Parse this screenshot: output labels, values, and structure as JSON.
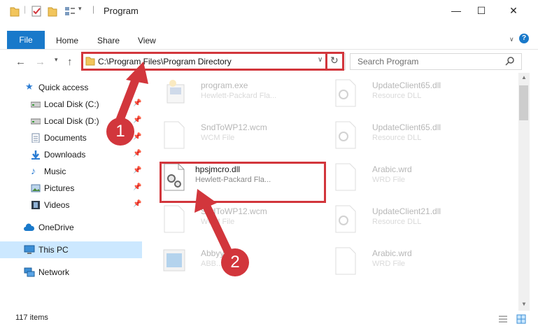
{
  "window": {
    "title": "Program",
    "minimize": "—",
    "maximize": "☐",
    "close": "✕"
  },
  "ribbon": {
    "tabs": [
      "File",
      "Home",
      "Share",
      "View"
    ]
  },
  "address": {
    "path": "C:\\Program Files\\Program Directory",
    "search_placeholder": "Search Program"
  },
  "sidebar": {
    "items": [
      {
        "label": "Quick access",
        "icon": "star-icon",
        "pinned": false
      },
      {
        "label": "Local Disk (C:)",
        "icon": "drive-icon",
        "pinned": true
      },
      {
        "label": "Local Disk (D:)",
        "icon": "drive-icon",
        "pinned": true
      },
      {
        "label": "Documents",
        "icon": "documents-icon",
        "pinned": true
      },
      {
        "label": "Downloads",
        "icon": "download-icon",
        "pinned": true
      },
      {
        "label": "Music",
        "icon": "music-icon",
        "pinned": true
      },
      {
        "label": "Pictures",
        "icon": "pictures-icon",
        "pinned": true
      },
      {
        "label": "Videos",
        "icon": "videos-icon",
        "pinned": true
      },
      {
        "label": "OneDrive",
        "icon": "cloud-icon",
        "pinned": false
      },
      {
        "label": "This PC",
        "icon": "computer-icon",
        "pinned": false
      },
      {
        "label": "Network",
        "icon": "network-icon",
        "pinned": false
      }
    ]
  },
  "files": [
    {
      "name": "program.exe",
      "type": "Hewlett-Packard Fla..."
    },
    {
      "name": "UpdateClient65.dll",
      "type": "Resource DLL"
    },
    {
      "name": "SndToWP12.wcm",
      "type": "WCM File"
    },
    {
      "name": "UpdateClient65.dll",
      "type": "Resource DLL"
    },
    {
      "name": "hpsjmcro.dll",
      "type": "Hewlett-Packard Fla..."
    },
    {
      "name": "Arabic.wrd",
      "type": "WRD File"
    },
    {
      "name": "SndToWP12.wcm",
      "type": "WCM File"
    },
    {
      "name": "UpdateClient21.dll",
      "type": "Resource DLL"
    },
    {
      "name": "Abbyy...exe",
      "type": "ABB... hand..."
    },
    {
      "name": "Arabic.wrd",
      "type": "WRD File"
    }
  ],
  "status": {
    "count": "117 items"
  },
  "callouts": [
    "1",
    "2"
  ],
  "colors": {
    "accent": "#1979ca",
    "highlight": "#d2363c",
    "selection": "#cce8ff"
  }
}
